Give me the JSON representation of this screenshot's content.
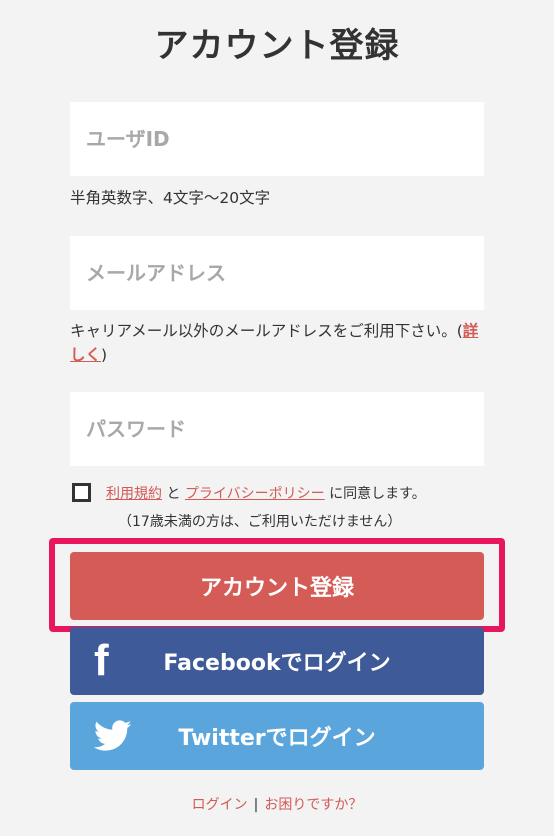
{
  "page": {
    "title": "アカウント登録"
  },
  "form": {
    "userid_placeholder": "ユーザID",
    "userid_hint": "半角英数字、4文字〜20文字",
    "email_placeholder": "メールアドレス",
    "email_hint_prefix": "キャリアメール以外のメールアドレスをご利用下さい。(",
    "email_hint_link": "詳しく",
    "email_hint_suffix": ")",
    "password_placeholder": "パスワード",
    "terms_link": "利用規約",
    "and_text": " と ",
    "privacy_link": "プライバシーポリシー",
    "agree_suffix": " に同意します。",
    "agree_note": "（17歳未満の方は、ご利用いただけません）"
  },
  "buttons": {
    "register": "アカウント登録",
    "facebook": "Facebookでログイン",
    "twitter": "Twitterでログイン"
  },
  "footer": {
    "login": "ログイン",
    "separator": "|",
    "help": "お困りですか？"
  },
  "colors": {
    "register": "#d55b56",
    "facebook": "#3f5a98",
    "twitter": "#5aa6dc",
    "highlight": "#e8175d",
    "link": "#d35a55"
  }
}
